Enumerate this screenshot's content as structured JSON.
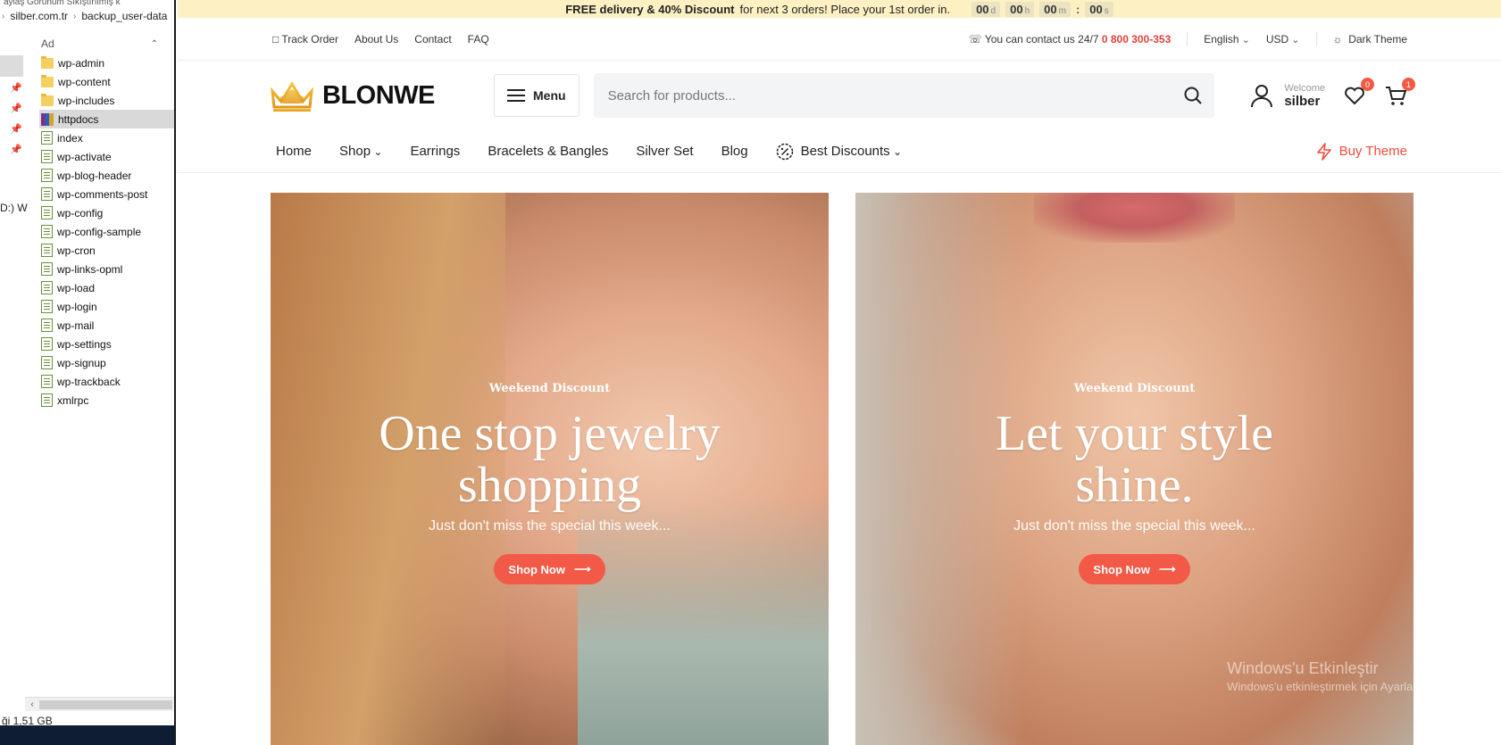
{
  "explorer": {
    "top_strip": "aylaş      Görünüm      Sıkıştırılmış k",
    "address": [
      "silber.com.tr",
      "backup_user-data"
    ],
    "column_header": "Ad",
    "drive_label": "D:) W",
    "items": [
      {
        "name": "wp-admin",
        "type": "folder"
      },
      {
        "name": "wp-content",
        "type": "folder"
      },
      {
        "name": "wp-includes",
        "type": "folder"
      },
      {
        "name": "httpdocs",
        "type": "archive"
      },
      {
        "name": "index",
        "type": "file"
      },
      {
        "name": "wp-activate",
        "type": "file"
      },
      {
        "name": "wp-blog-header",
        "type": "file"
      },
      {
        "name": "wp-comments-post",
        "type": "file"
      },
      {
        "name": "wp-config",
        "type": "file"
      },
      {
        "name": "wp-config-sample",
        "type": "file"
      },
      {
        "name": "wp-cron",
        "type": "file"
      },
      {
        "name": "wp-links-opml",
        "type": "file"
      },
      {
        "name": "wp-load",
        "type": "file"
      },
      {
        "name": "wp-login",
        "type": "file"
      },
      {
        "name": "wp-mail",
        "type": "file"
      },
      {
        "name": "wp-settings",
        "type": "file"
      },
      {
        "name": "wp-signup",
        "type": "file"
      },
      {
        "name": "wp-trackback",
        "type": "file"
      },
      {
        "name": "xmlrpc",
        "type": "file"
      }
    ],
    "status": "ği  1,51 GB"
  },
  "promo": {
    "bold": "FREE delivery & 40% Discount",
    "text": "for next 3 orders! Place your 1st order in.",
    "timer": [
      {
        "value": "00",
        "unit": "d"
      },
      {
        "value": "00",
        "unit": "h"
      },
      {
        "value": "00",
        "unit": "m"
      },
      {
        "value": "00",
        "unit": "s"
      }
    ]
  },
  "topbar": {
    "links": [
      "Track Order",
      "About Us",
      "Contact",
      "FAQ"
    ],
    "contact_text": "You can contact us 24/7",
    "phone": "0 800 300-353",
    "language": "English",
    "currency": "USD",
    "theme": "Dark Theme"
  },
  "header": {
    "logo": "BLONWE",
    "menu_label": "Menu",
    "search_placeholder": "Search for products...",
    "welcome": "Welcome",
    "username": "silber",
    "wishlist_count": "0",
    "cart_count": "1"
  },
  "nav": {
    "items": [
      "Home",
      "Shop",
      "Earrings",
      "Bracelets & Bangles",
      "Silver Set",
      "Blog",
      "Best Discounts"
    ],
    "buy_theme": "Buy Theme"
  },
  "banners": [
    {
      "kicker": "Weekend Discount",
      "title": "One stop jewelry shopping",
      "subtitle": "Just don't miss the special this week...",
      "button": "Shop Now"
    },
    {
      "kicker": "Weekend Discount",
      "title": "Let your style shine.",
      "subtitle": "Just don't miss the special this week...",
      "button": "Shop Now"
    }
  ],
  "watermark": {
    "line1": "Windows'u Etkinleştir",
    "line2": "Windows'u etkinleştirmek için Ayarlar'a gidin."
  },
  "colors": {
    "accent": "#f25a47",
    "promo_bg": "#fdf1c4",
    "phone": "#e0413a"
  }
}
